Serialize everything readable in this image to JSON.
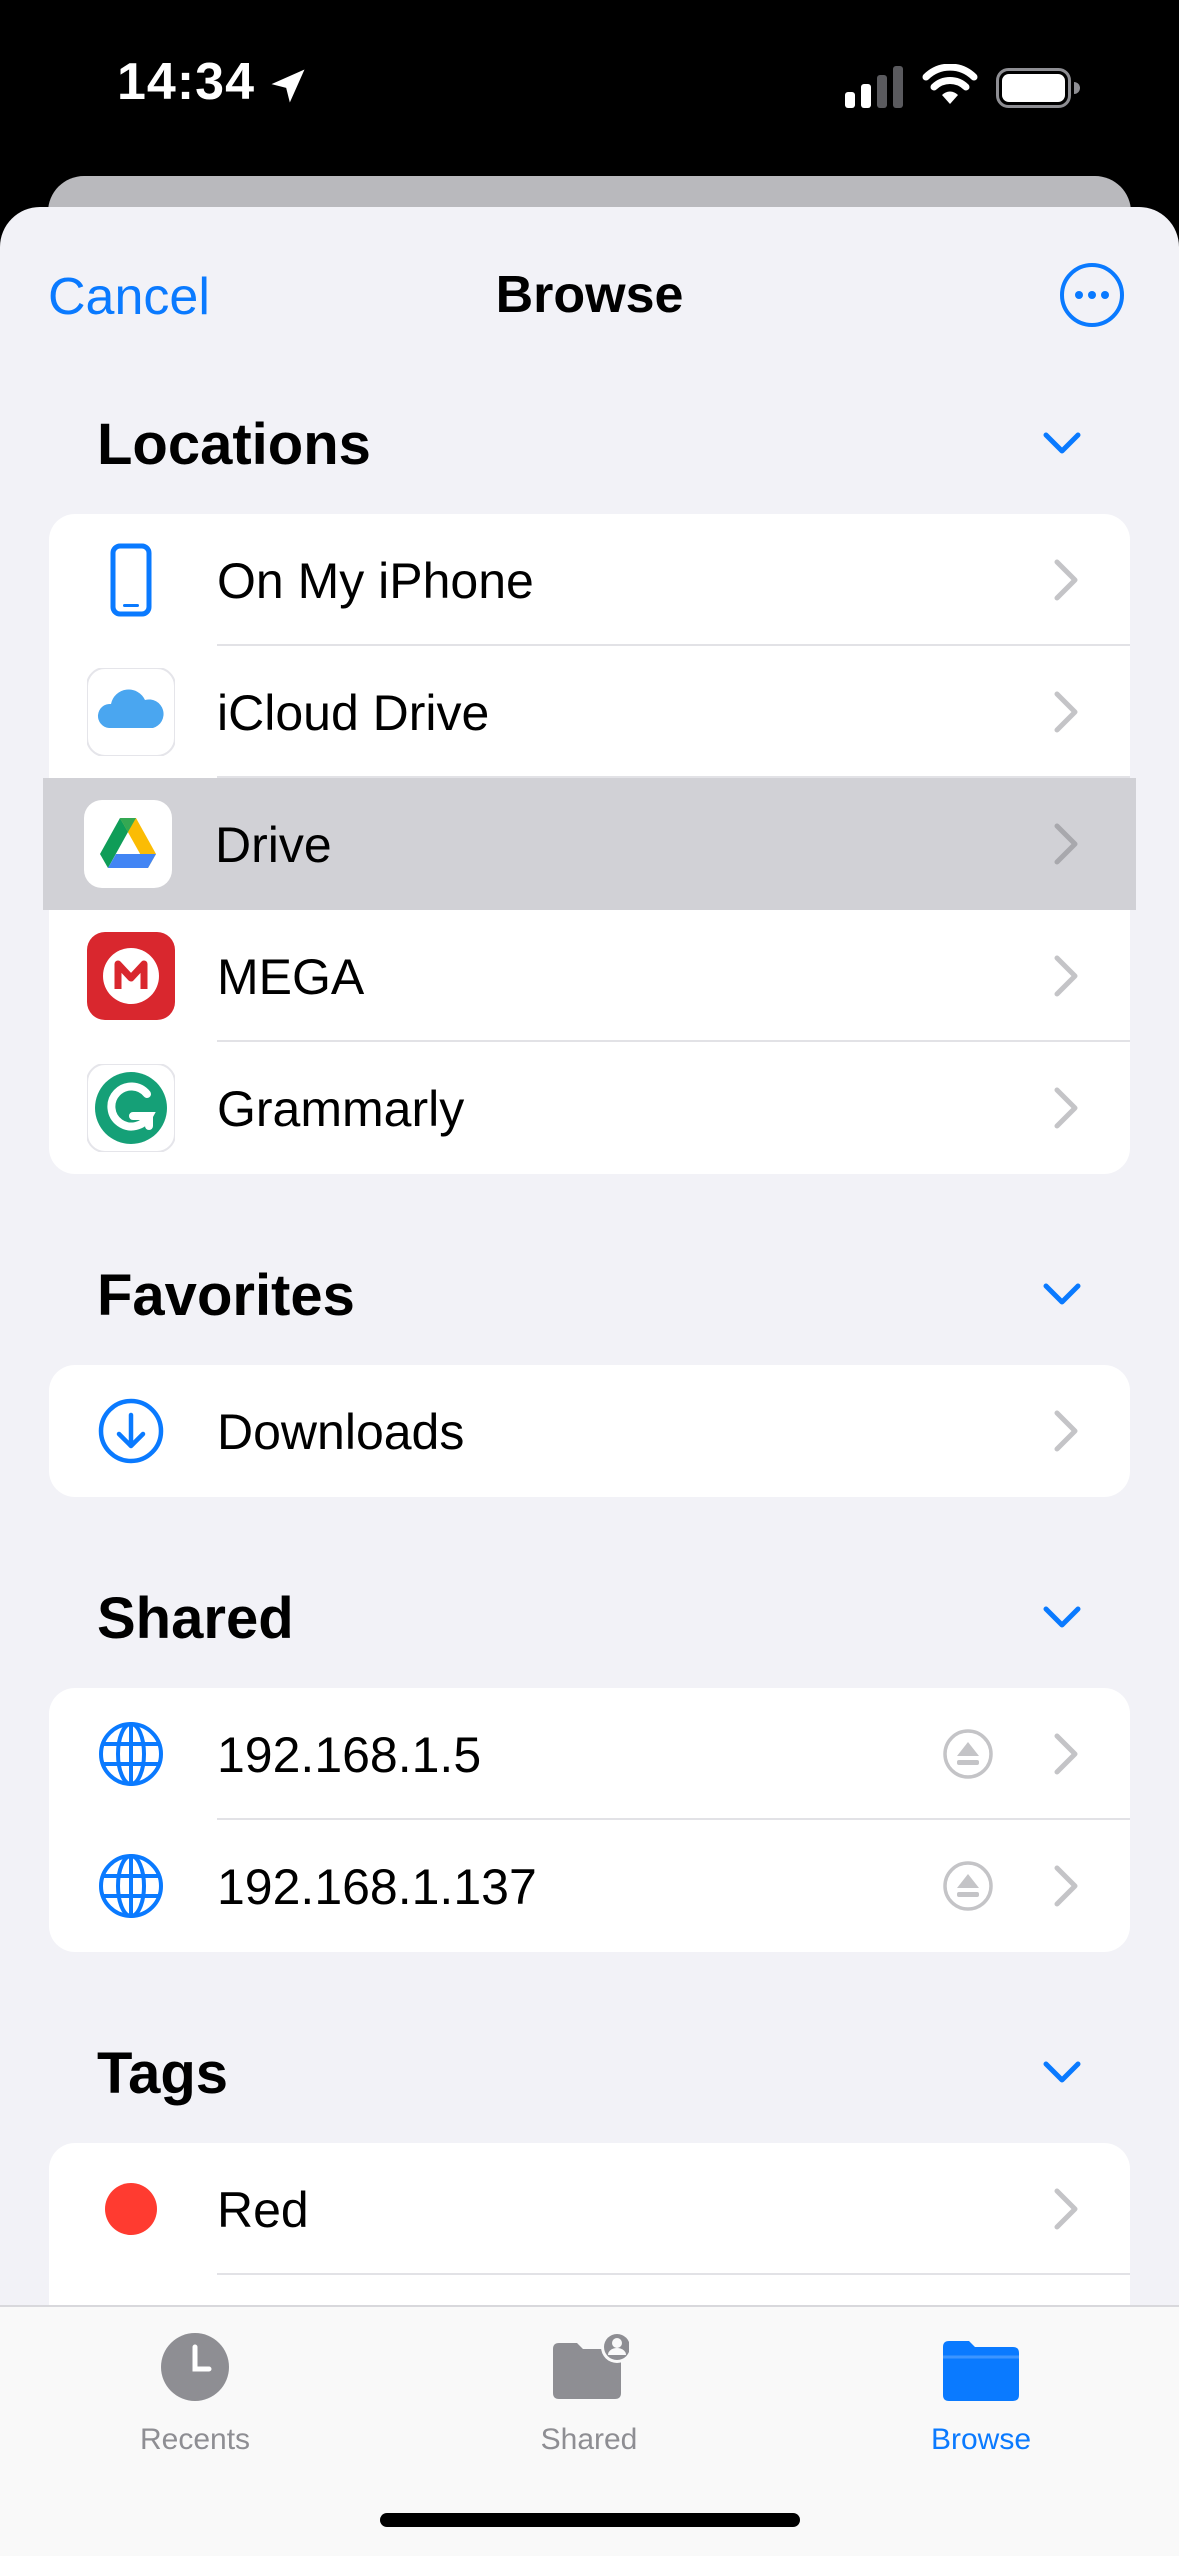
{
  "status_bar": {
    "time": "14:34"
  },
  "nav": {
    "cancel": "Cancel",
    "title": "Browse"
  },
  "locations": {
    "header": "Locations",
    "items": [
      {
        "label": "On My iPhone",
        "icon": "iphone-icon"
      },
      {
        "label": "iCloud Drive",
        "icon": "icloud-icon"
      },
      {
        "label": "Drive",
        "icon": "google-drive-icon",
        "highlighted": true
      },
      {
        "label": "MEGA",
        "icon": "mega-icon"
      },
      {
        "label": "Grammarly",
        "icon": "grammarly-icon"
      }
    ]
  },
  "favorites": {
    "header": "Favorites",
    "items": [
      {
        "label": "Downloads",
        "icon": "download-circle-icon"
      }
    ]
  },
  "shared": {
    "header": "Shared",
    "items": [
      {
        "label": "192.168.1.5",
        "icon": "globe-icon"
      },
      {
        "label": "192.168.1.137",
        "icon": "globe-icon"
      }
    ]
  },
  "tags": {
    "header": "Tags",
    "items": [
      {
        "label": "Red",
        "color": "#ff3b30"
      }
    ]
  },
  "tab_bar": {
    "tabs": [
      {
        "label": "Recents",
        "icon": "clock-icon"
      },
      {
        "label": "Shared",
        "icon": "shared-folder-icon"
      },
      {
        "label": "Browse",
        "icon": "folder-icon",
        "active": true
      }
    ]
  },
  "colors": {
    "accent": "#0a7aff",
    "sheet_bg": "#f2f2f7",
    "highlight": "#d1d1d6"
  }
}
